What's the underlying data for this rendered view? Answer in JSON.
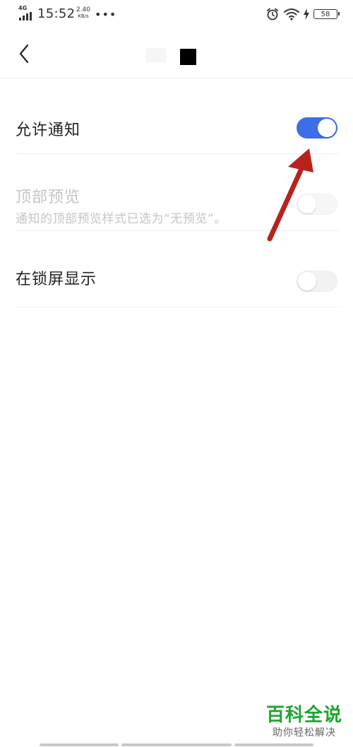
{
  "status_bar": {
    "network_type": "4G",
    "time": "15:52",
    "speed_value": "2.40",
    "speed_unit": "KB/s",
    "more": "•••",
    "battery_level": "58",
    "icons": [
      "signal-icon",
      "alarm-icon",
      "wifi-icon",
      "charging-icon",
      "battery-icon"
    ]
  },
  "header": {
    "back_icon": "chevron-left-icon"
  },
  "settings": {
    "allow_notifications": {
      "label": "允许通知",
      "enabled": true
    },
    "top_preview": {
      "label": "顶部预览",
      "sub": "通知的顶部预览样式已选为“无预览”。",
      "enabled": false,
      "disabled": true
    },
    "lock_screen": {
      "label": "在锁屏显示",
      "enabled": false
    }
  },
  "watermark": {
    "brand": "百科全说",
    "slogan": "助你轻松解决"
  },
  "colors": {
    "accent": "#3d6ee8",
    "annotation": "#b8221d",
    "watermark": "#1ea52f"
  }
}
